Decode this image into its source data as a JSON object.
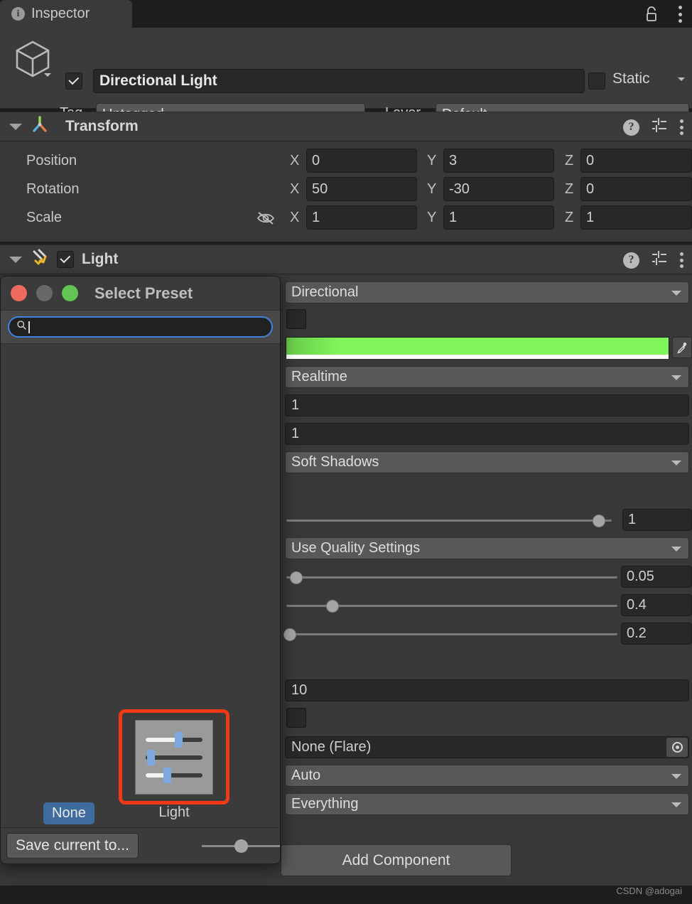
{
  "window": {
    "tab_label": "Inspector",
    "info_icon": "info-icon",
    "lock_icon": "lock-open-icon",
    "menu_icon": "kebab-menu-icon"
  },
  "object_header": {
    "enabled": true,
    "name": "Directional Light",
    "static_label": "Static",
    "static_checked": false,
    "tag_label": "Tag",
    "tag_value": "Untagged",
    "layer_label": "Layer",
    "layer_value": "Default"
  },
  "transform": {
    "title": "Transform",
    "rows": [
      {
        "label": "Position",
        "x": "0",
        "y": "3",
        "z": "0"
      },
      {
        "label": "Rotation",
        "x": "50",
        "y": "-30",
        "z": "0"
      },
      {
        "label": "Scale",
        "x": "1",
        "y": "1",
        "z": "1"
      }
    ],
    "axis_x": "X",
    "axis_y": "Y",
    "axis_z": "Z"
  },
  "light": {
    "title": "Light",
    "enabled": true,
    "type_value": "Directional",
    "color_hex": "#80f55a",
    "mode_value": "Realtime",
    "intensity_value": "1",
    "bounce_value": "1",
    "shadow_type_value": "Soft Shadows",
    "strength_value": "1",
    "strength_slider_pct": 96,
    "resolution_value": "Use Quality Settings",
    "bias_value": "0.05",
    "bias_slider_pct": 3,
    "normal_bias_value": "0.4",
    "normal_bias_slider_pct": 14,
    "near_plane_value": "0.2",
    "near_plane_slider_pct": 1,
    "draw_halo_checked": false,
    "range_value": "10",
    "flare_value": "None (Flare)",
    "render_mode_value": "Auto",
    "culling_mask_value": "Everything"
  },
  "add_component": {
    "label": "Add Component"
  },
  "select_preset": {
    "title": "Select Preset",
    "traffic_lights": [
      "close-button",
      "minimize-button",
      "zoom-button"
    ],
    "search_placeholder": "",
    "search_value": "",
    "none_label": "None",
    "items": [
      {
        "label": "Light",
        "selected": true,
        "icon": "sliders-icon"
      }
    ],
    "save_button_label": "Save current to...",
    "zoom_slider_pct": 50,
    "highlight_color": "#f03a16"
  },
  "watermark": {
    "text": "CSDN @adogai"
  }
}
